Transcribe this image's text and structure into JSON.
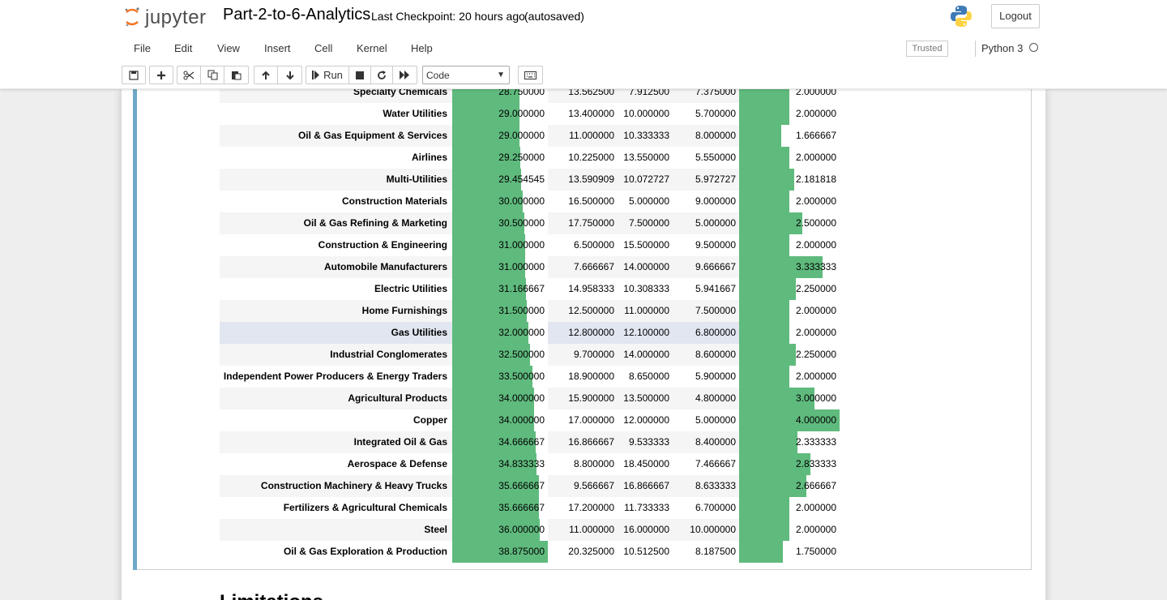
{
  "header": {
    "logo_text": "jupyter",
    "notebook_title": "Part-2-to-6-Analytics",
    "checkpoint": "Last Checkpoint: 20 hours ago",
    "autosave": "(autosaved)",
    "logout_label": "Logout"
  },
  "menu": [
    "File",
    "Edit",
    "View",
    "Insert",
    "Cell",
    "Kernel",
    "Help"
  ],
  "trusted_label": "Trusted",
  "kernel": {
    "name": "Python 3"
  },
  "toolbar": {
    "run_label": "Run",
    "cell_type": "Code",
    "icons": [
      "save-icon",
      "plus-icon",
      "cut-icon",
      "copy-icon",
      "paste-icon",
      "arrow-up-icon",
      "arrow-down-icon",
      "run-icon",
      "stop-icon",
      "restart-icon",
      "fast-forward-icon",
      "keyboard-icon"
    ]
  },
  "colors": {
    "bar": "#5fba7d",
    "cell_accent": "#6fa9c9"
  },
  "table": {
    "rows": [
      {
        "name": "Specialty Chemicals",
        "c1": "28.750000",
        "c2": "13.562500",
        "c3": "7.912500",
        "c4": "7.375000",
        "c5": "2.000000"
      },
      {
        "name": "Water Utilities",
        "c1": "29.000000",
        "c2": "13.400000",
        "c3": "10.000000",
        "c4": "5.700000",
        "c5": "2.000000"
      },
      {
        "name": "Oil & Gas Equipment & Services",
        "c1": "29.000000",
        "c2": "11.000000",
        "c3": "10.333333",
        "c4": "8.000000",
        "c5": "1.666667"
      },
      {
        "name": "Airlines",
        "c1": "29.250000",
        "c2": "10.225000",
        "c3": "13.550000",
        "c4": "5.550000",
        "c5": "2.000000"
      },
      {
        "name": "Multi-Utilities",
        "c1": "29.454545",
        "c2": "13.590909",
        "c3": "10.072727",
        "c4": "5.972727",
        "c5": "2.181818"
      },
      {
        "name": "Construction Materials",
        "c1": "30.000000",
        "c2": "16.500000",
        "c3": "5.000000",
        "c4": "9.000000",
        "c5": "2.000000"
      },
      {
        "name": "Oil & Gas Refining & Marketing",
        "c1": "30.500000",
        "c2": "17.750000",
        "c3": "7.500000",
        "c4": "5.000000",
        "c5": "2.500000"
      },
      {
        "name": "Construction & Engineering",
        "c1": "31.000000",
        "c2": "6.500000",
        "c3": "15.500000",
        "c4": "9.500000",
        "c5": "2.000000"
      },
      {
        "name": "Automobile Manufacturers",
        "c1": "31.000000",
        "c2": "7.666667",
        "c3": "14.000000",
        "c4": "9.666667",
        "c5": "3.333333"
      },
      {
        "name": "Electric Utilities",
        "c1": "31.166667",
        "c2": "14.958333",
        "c3": "10.308333",
        "c4": "5.941667",
        "c5": "2.250000"
      },
      {
        "name": "Home Furnishings",
        "c1": "31.500000",
        "c2": "12.500000",
        "c3": "11.000000",
        "c4": "7.500000",
        "c5": "2.000000"
      },
      {
        "name": "Gas Utilities",
        "c1": "32.000000",
        "c2": "12.800000",
        "c3": "12.100000",
        "c4": "6.800000",
        "c5": "2.000000"
      },
      {
        "name": "Industrial Conglomerates",
        "c1": "32.500000",
        "c2": "9.700000",
        "c3": "14.000000",
        "c4": "8.600000",
        "c5": "2.250000"
      },
      {
        "name": "Independent Power Producers & Energy Traders",
        "c1": "33.500000",
        "c2": "18.900000",
        "c3": "8.650000",
        "c4": "5.900000",
        "c5": "2.000000"
      },
      {
        "name": "Agricultural Products",
        "c1": "34.000000",
        "c2": "15.900000",
        "c3": "13.500000",
        "c4": "4.800000",
        "c5": "3.000000"
      },
      {
        "name": "Copper",
        "c1": "34.000000",
        "c2": "17.000000",
        "c3": "12.000000",
        "c4": "5.000000",
        "c5": "4.000000"
      },
      {
        "name": "Integrated Oil & Gas",
        "c1": "34.666667",
        "c2": "16.866667",
        "c3": "9.533333",
        "c4": "8.400000",
        "c5": "2.333333"
      },
      {
        "name": "Aerospace & Defense",
        "c1": "34.833333",
        "c2": "8.800000",
        "c3": "18.450000",
        "c4": "7.466667",
        "c5": "2.833333"
      },
      {
        "name": "Construction Machinery & Heavy Trucks",
        "c1": "35.666667",
        "c2": "9.566667",
        "c3": "16.866667",
        "c4": "8.633333",
        "c5": "2.666667"
      },
      {
        "name": "Fertilizers & Agricultural Chemicals",
        "c1": "35.666667",
        "c2": "17.200000",
        "c3": "11.733333",
        "c4": "6.700000",
        "c5": "2.000000"
      },
      {
        "name": "Steel",
        "c1": "36.000000",
        "c2": "11.000000",
        "c3": "16.000000",
        "c4": "10.000000",
        "c5": "2.000000"
      },
      {
        "name": "Oil & Gas Exploration & Production",
        "c1": "38.875000",
        "c2": "20.325000",
        "c3": "10.512500",
        "c4": "8.187500",
        "c5": "1.750000"
      }
    ]
  },
  "next_heading": "Limitations"
}
